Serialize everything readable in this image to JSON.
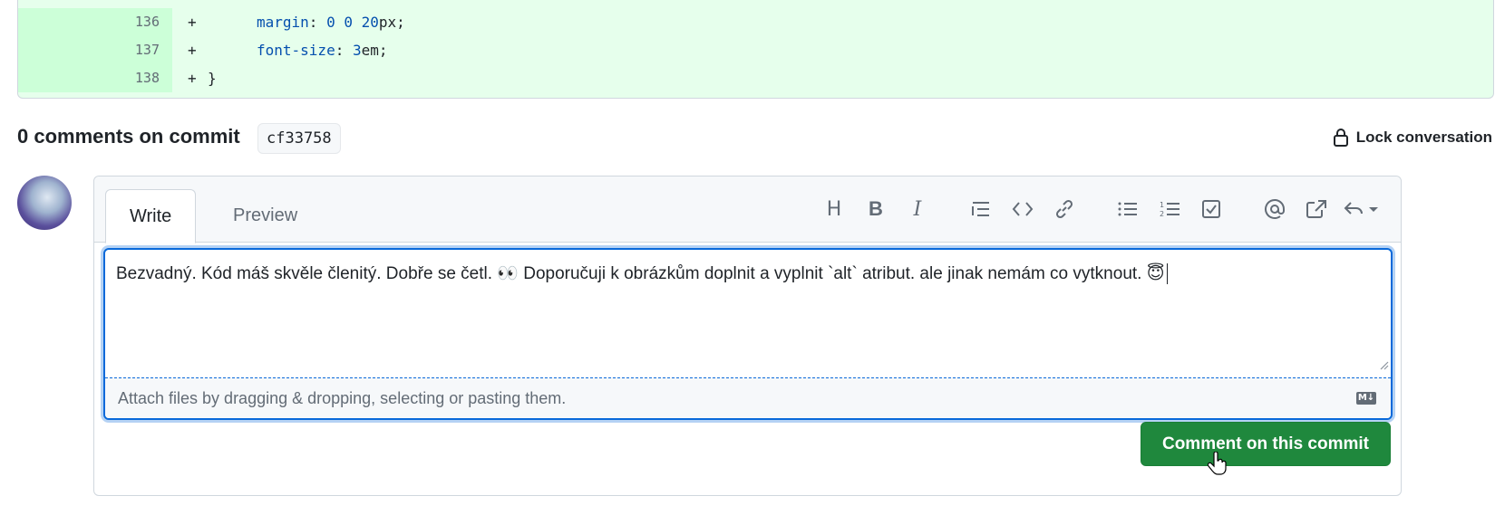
{
  "diff": {
    "lines": [
      {
        "num": "136",
        "prefix": "+",
        "prop": "margin",
        "sep": ": ",
        "value_num": "0 0 20",
        "value_unit": "px;"
      },
      {
        "num": "137",
        "prefix": "+",
        "prop": "font-size",
        "sep": ": ",
        "value_num": "3",
        "value_unit": "em;"
      },
      {
        "num": "138",
        "prefix": "+",
        "brace": "}"
      }
    ]
  },
  "header": {
    "title": "0 comments on commit",
    "sha": "cf33758",
    "lock_label": "Lock conversation"
  },
  "tabs": {
    "write": "Write",
    "preview": "Preview"
  },
  "toolbar": {
    "icons": [
      "heading-icon",
      "bold-icon",
      "italic-icon",
      "quote-icon",
      "code-icon",
      "link-icon",
      "bulleted-list-icon",
      "numbered-list-icon",
      "task-list-icon",
      "mention-icon",
      "cross-reference-icon",
      "saved-reply-icon"
    ],
    "heading": "H",
    "bold": "B",
    "italic": "I"
  },
  "editor": {
    "value": "Bezvadný. Kód máš skvěle členitý. Dobře se četl. 👀 Doporučuji k obrázkům doplnit a vyplnit `alt` atribut. ale jinak nemám co vytknout. 😇",
    "attach_hint": "Attach files by dragging & dropping, selecting or pasting them.",
    "markdown_badge": "M↓"
  },
  "submit_label": "Comment on this commit",
  "colors": {
    "diff_bg": "#e6ffec",
    "diff_gutter": "#ccffd8",
    "accent_blue": "#0969da",
    "button_green": "#1f883d"
  }
}
